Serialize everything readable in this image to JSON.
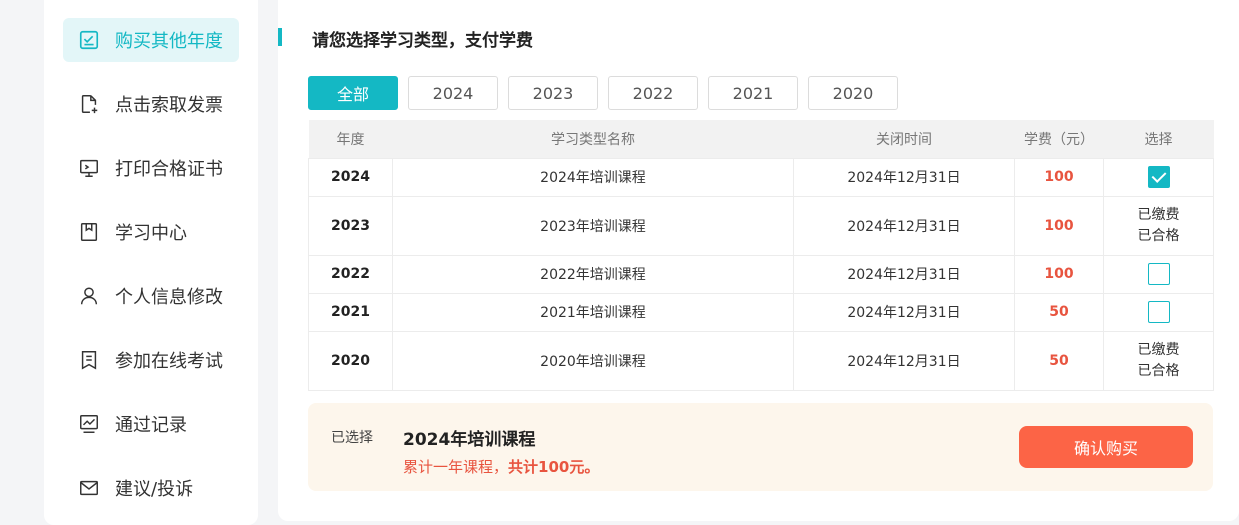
{
  "sidebar": {
    "items": [
      {
        "label": "购买其他年度",
        "icon": "checkbox-icon"
      },
      {
        "label": "点击索取发票",
        "icon": "invoice-icon"
      },
      {
        "label": "打印合格证书",
        "icon": "print-icon"
      },
      {
        "label": "学习中心",
        "icon": "bookmark-icon"
      },
      {
        "label": "个人信息修改",
        "icon": "user-icon"
      },
      {
        "label": "参加在线考试",
        "icon": "exam-icon"
      },
      {
        "label": "通过记录",
        "icon": "chart-icon"
      },
      {
        "label": "建议/投诉",
        "icon": "mail-icon"
      }
    ],
    "active_index": 0
  },
  "main": {
    "title": "请您选择学习类型，支付学费",
    "year_tabs": [
      "全部",
      "2024",
      "2023",
      "2022",
      "2021",
      "2020"
    ],
    "table": {
      "headers": [
        "年度",
        "学习类型名称",
        "关闭时间",
        "学费（元）",
        "选择"
      ],
      "rows": [
        {
          "year": "2024",
          "name": "2024年培训课程",
          "close": "2024年12月31日",
          "fee": "100",
          "status": "checked"
        },
        {
          "year": "2023",
          "name": "2023年培训课程",
          "close": "2024年12月31日",
          "fee": "100",
          "status": "paid",
          "paid_line1": "已缴费",
          "paid_line2": "已合格"
        },
        {
          "year": "2022",
          "name": "2022年培训课程",
          "close": "2024年12月31日",
          "fee": "100",
          "status": "unchecked"
        },
        {
          "year": "2021",
          "name": "2021年培训课程",
          "close": "2024年12月31日",
          "fee": "50",
          "status": "unchecked"
        },
        {
          "year": "2020",
          "name": "2020年培训课程",
          "close": "2024年12月31日",
          "fee": "50",
          "status": "paid",
          "paid_line1": "已缴费",
          "paid_line2": "已合格"
        }
      ]
    },
    "summary": {
      "label": "已选择",
      "course": "2024年培训课程",
      "total_prefix": "累计一年课程，",
      "total_emphasis": "共计100元。",
      "confirm_label": "确认购买"
    }
  },
  "colors": {
    "accent": "#14b8c4",
    "fee": "#e8543f",
    "confirm": "#fc6446",
    "summary_bg": "#fdf6ec"
  }
}
